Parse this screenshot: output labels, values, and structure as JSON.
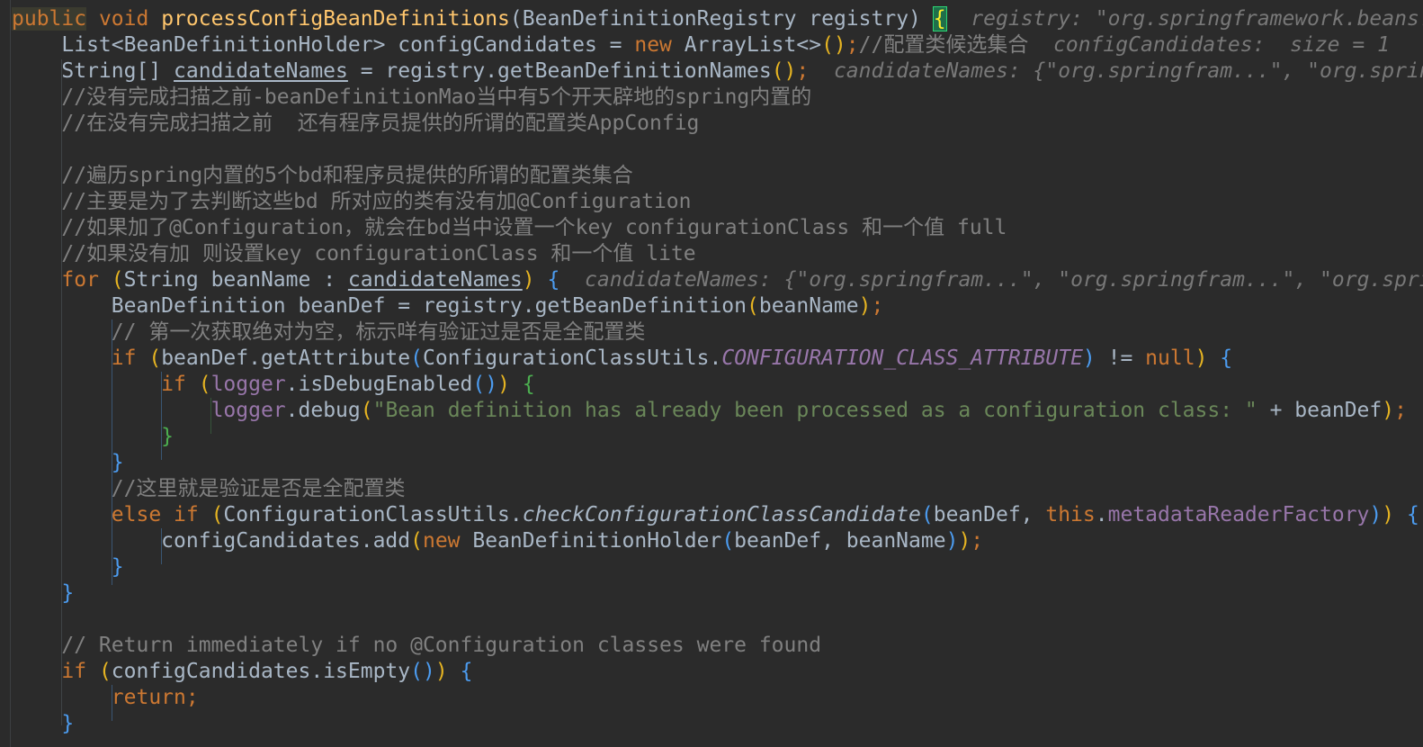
{
  "editor": {
    "lines": [
      [
        {
          "t": "public",
          "c": "kw selection-hl"
        },
        {
          "t": " void ",
          "c": "kw"
        },
        {
          "t": "processConfigBeanDefinitions",
          "c": "fn"
        },
        {
          "t": "(",
          "c": "plain"
        },
        {
          "t": "BeanDefinitionRegistry registry",
          "c": "plain"
        },
        {
          "t": ") ",
          "c": "plain"
        },
        {
          "t": "{",
          "c": "brace-match"
        },
        {
          "t": "  registry: \"org.springframework.beans.",
          "c": "inline-hint"
        }
      ],
      [
        {
          "t": "    List<BeanDefinitionHolder> configCandidates = ",
          "c": "plain"
        },
        {
          "t": "new ",
          "c": "kw"
        },
        {
          "t": "ArrayList<>",
          "c": "plain"
        },
        {
          "t": "()",
          "c": "paren-yellow"
        },
        {
          "t": ";",
          "c": "punct"
        },
        {
          "t": "//配置类候选集合",
          "c": "comment"
        },
        {
          "t": "  configCandidates:  size = 1",
          "c": "inline-hint"
        }
      ],
      [
        {
          "t": "    String[] ",
          "c": "plain"
        },
        {
          "t": "candidateNames",
          "c": "plain underline"
        },
        {
          "t": " = registry.getBeanDefinitionNames",
          "c": "plain"
        },
        {
          "t": "()",
          "c": "paren-yellow"
        },
        {
          "t": ";",
          "c": "punct"
        },
        {
          "t": "  candidateNames: {\"org.springfram...\", \"org.spring",
          "c": "inline-hint"
        }
      ],
      [
        {
          "t": "    //没有完成扫描之前-beanDefinitionMao当中有5个开天辟地的spring内置的",
          "c": "comment"
        }
      ],
      [
        {
          "t": "    //在没有完成扫描之前  还有程序员提供的所谓的配置类AppConfig",
          "c": "comment"
        }
      ],
      [],
      [
        {
          "t": "    //遍历spring内置的5个bd和程序员提供的所谓的配置类集合",
          "c": "comment"
        }
      ],
      [
        {
          "t": "    //主要是为了去判断这些bd 所对应的类有没有加@Configuration",
          "c": "comment"
        }
      ],
      [
        {
          "t": "    //如果加了@Configuration，就会在bd当中设置一个key configurationClass 和一个值 full",
          "c": "comment"
        }
      ],
      [
        {
          "t": "    //如果没有加 则设置key configurationClass 和一个值 lite",
          "c": "comment"
        }
      ],
      [
        {
          "t": "    for ",
          "c": "kw"
        },
        {
          "t": "(",
          "c": "paren-yellow"
        },
        {
          "t": "String beanName : ",
          "c": "plain"
        },
        {
          "t": "candidateNames",
          "c": "plain underline"
        },
        {
          "t": ")",
          "c": "paren-yellow"
        },
        {
          "t": " ",
          "c": "plain"
        },
        {
          "t": "{",
          "c": "paren-blue"
        },
        {
          "t": "  candidateNames: {\"org.springfram...\", \"org.springfram...\", \"org.spring",
          "c": "inline-hint"
        }
      ],
      [
        {
          "t": "        BeanDefinition beanDef = registry.getBeanDefinition",
          "c": "plain"
        },
        {
          "t": "(",
          "c": "paren-yellow"
        },
        {
          "t": "beanName",
          "c": "plain"
        },
        {
          "t": ")",
          "c": "paren-yellow"
        },
        {
          "t": ";",
          "c": "punct"
        }
      ],
      [
        {
          "t": "        // 第一次获取绝对为空，标示咩有验证过是否是全配置类",
          "c": "comment"
        }
      ],
      [
        {
          "t": "        if ",
          "c": "kw"
        },
        {
          "t": "(",
          "c": "paren-yellow"
        },
        {
          "t": "beanDef.getAttribute",
          "c": "plain"
        },
        {
          "t": "(",
          "c": "paren-blue"
        },
        {
          "t": "ConfigurationClassUtils.",
          "c": "plain"
        },
        {
          "t": "CONFIGURATION_CLASS_ATTRIBUTE",
          "c": "const"
        },
        {
          "t": ")",
          "c": "paren-blue"
        },
        {
          "t": " != ",
          "c": "plain"
        },
        {
          "t": "null",
          "c": "kw"
        },
        {
          "t": ")",
          "c": "paren-yellow"
        },
        {
          "t": " ",
          "c": "plain"
        },
        {
          "t": "{",
          "c": "paren-blue"
        }
      ],
      [
        {
          "t": "            if ",
          "c": "kw"
        },
        {
          "t": "(",
          "c": "paren-yellow"
        },
        {
          "t": "logger",
          "c": "field"
        },
        {
          "t": ".isDebugEnabled",
          "c": "plain"
        },
        {
          "t": "()",
          "c": "paren-blue"
        },
        {
          "t": ")",
          "c": "paren-yellow"
        },
        {
          "t": " ",
          "c": "plain"
        },
        {
          "t": "{",
          "c": "paren-green"
        }
      ],
      [
        {
          "t": "                ",
          "c": "plain"
        },
        {
          "t": "logger",
          "c": "field"
        },
        {
          "t": ".debug",
          "c": "plain"
        },
        {
          "t": "(",
          "c": "paren-yellow"
        },
        {
          "t": "\"Bean definition has already been processed as a configuration class: \"",
          "c": "str"
        },
        {
          "t": " + beanDef",
          "c": "plain"
        },
        {
          "t": ")",
          "c": "paren-yellow"
        },
        {
          "t": ";",
          "c": "punct"
        }
      ],
      [
        {
          "t": "            ",
          "c": "plain"
        },
        {
          "t": "}",
          "c": "paren-green"
        }
      ],
      [
        {
          "t": "        ",
          "c": "plain"
        },
        {
          "t": "}",
          "c": "paren-blue"
        }
      ],
      [
        {
          "t": "        //这里就是验证是否是全配置类",
          "c": "comment"
        }
      ],
      [
        {
          "t": "        else if ",
          "c": "kw"
        },
        {
          "t": "(",
          "c": "paren-yellow"
        },
        {
          "t": "ConfigurationClassUtils.",
          "c": "plain"
        },
        {
          "t": "checkConfigurationClassCandidate",
          "c": "plain static-call"
        },
        {
          "t": "(",
          "c": "paren-blue"
        },
        {
          "t": "beanDef, ",
          "c": "plain"
        },
        {
          "t": "this",
          "c": "kw"
        },
        {
          "t": ".",
          "c": "plain"
        },
        {
          "t": "metadataReaderFactory",
          "c": "field"
        },
        {
          "t": ")",
          "c": "paren-blue"
        },
        {
          "t": ")",
          "c": "paren-yellow"
        },
        {
          "t": " ",
          "c": "plain"
        },
        {
          "t": "{",
          "c": "paren-blue"
        }
      ],
      [
        {
          "t": "            configCandidates.add",
          "c": "plain"
        },
        {
          "t": "(",
          "c": "paren-yellow"
        },
        {
          "t": "new ",
          "c": "kw"
        },
        {
          "t": "BeanDefinitionHolder",
          "c": "plain"
        },
        {
          "t": "(",
          "c": "paren-blue"
        },
        {
          "t": "beanDef, beanName",
          "c": "plain"
        },
        {
          "t": ")",
          "c": "paren-blue"
        },
        {
          "t": ")",
          "c": "paren-yellow"
        },
        {
          "t": ";",
          "c": "punct"
        }
      ],
      [
        {
          "t": "        ",
          "c": "plain"
        },
        {
          "t": "}",
          "c": "paren-blue"
        }
      ],
      [
        {
          "t": "    ",
          "c": "plain"
        },
        {
          "t": "}",
          "c": "paren-blue"
        }
      ],
      [],
      [
        {
          "t": "    // Return immediately if no @Configuration classes were found",
          "c": "comment"
        }
      ],
      [
        {
          "t": "    if ",
          "c": "kw"
        },
        {
          "t": "(",
          "c": "paren-yellow"
        },
        {
          "t": "configCandidates.isEmpty",
          "c": "plain"
        },
        {
          "t": "()",
          "c": "paren-blue"
        },
        {
          "t": ")",
          "c": "paren-yellow"
        },
        {
          "t": " ",
          "c": "plain"
        },
        {
          "t": "{",
          "c": "paren-blue"
        }
      ],
      [
        {
          "t": "        return",
          "c": "kw"
        },
        {
          "t": ";",
          "c": "punct"
        }
      ],
      [
        {
          "t": "    ",
          "c": "plain"
        },
        {
          "t": "}",
          "c": "paren-blue"
        }
      ]
    ]
  },
  "theme": {
    "background": "#2b2b2b",
    "keyword": "#cc7832",
    "method_decl": "#ffc66d",
    "comment": "#808080",
    "string": "#6a8759",
    "field": "#9876aa",
    "text": "#a9b7c6",
    "brace_match_bg": "#1f6f4a"
  }
}
